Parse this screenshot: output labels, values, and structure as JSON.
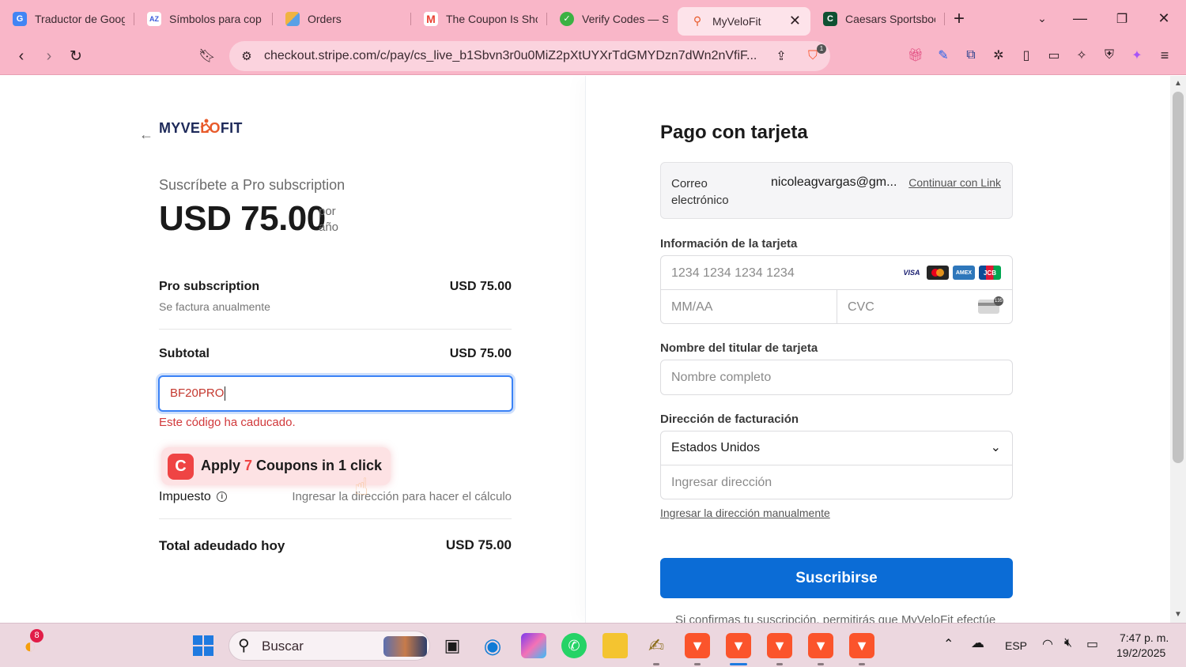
{
  "browser": {
    "tabs": [
      {
        "title": "Traductor de Goog",
        "favicon_color": "#4285f4",
        "favicon_glyph": "G"
      },
      {
        "title": "Símbolos para cop",
        "favicon_color": "#3b5bdb",
        "favicon_glyph": "AZ"
      },
      {
        "title": "Orders",
        "favicon_color": "#e3a13a",
        "favicon_glyph": "▦"
      },
      {
        "title": "The Coupon Is Sho",
        "favicon_color": "#ea4335",
        "favicon_glyph": "M"
      },
      {
        "title": "Verify Codes — Si",
        "favicon_color": "#3bb143",
        "favicon_glyph": "✓"
      },
      {
        "title": "MyVeloFit",
        "favicon_color": "#e85a2a",
        "favicon_glyph": "⚲",
        "active": true
      },
      {
        "title": "Caesars Sportsboo",
        "favicon_color": "#0f5132",
        "favicon_glyph": "C"
      }
    ],
    "url": "checkout.stripe.com/c/pay/cs_live_b1Sbvn3r0u0MiZ2pXtUYXrTdGMYDzn7dWn2nVfiF...",
    "shield_badge": "1"
  },
  "checkout": {
    "logo_part1": "MYVE",
    "logo_part2": "LO",
    "logo_part3": "FIT",
    "subscribe_title": "Suscríbete a Pro subscription",
    "price": "USD 75.00",
    "period_line1": "por",
    "period_line2": "año",
    "item_name": "Pro subscription",
    "item_price": "USD 75.00",
    "item_billing": "Se factura anualmente",
    "subtotal_label": "Subtotal",
    "subtotal_value": "USD 75.00",
    "coupon_value": "BF20PRO",
    "coupon_error": "Este código ha caducado.",
    "tax_label": "Impuesto",
    "tax_hint": "Ingresar la dirección para hacer el cálculo",
    "total_label": "Total adeudado hoy",
    "total_value": "USD 75.00"
  },
  "extension_popup": {
    "prefix": "Apply ",
    "count": "7",
    "suffix": " Coupons in 1 click",
    "badge_glyph": "C"
  },
  "payment": {
    "title": "Pago con tarjeta",
    "email_label": "Correo electrónico",
    "email_value": "nicoleagvargas@gm...",
    "link_button": "Continuar con Link",
    "card_info_label": "Información de la tarjeta",
    "card_number_placeholder": "1234 1234 1234 1234",
    "expiry_placeholder": "MM/AA",
    "cvc_placeholder": "CVC",
    "card_brands": [
      "VISA",
      "MC",
      "AMEX",
      "JCB"
    ],
    "holder_label": "Nombre del titular de tarjeta",
    "holder_placeholder": "Nombre completo",
    "billing_label": "Dirección de facturación",
    "country": "Estados Unidos",
    "address_placeholder": "Ingresar dirección",
    "manual_address_link": "Ingresar la dirección manualmente",
    "submit_label": "Suscribirse",
    "footnote": "Si confirmas tu suscripción, permitirás que MyVeloFit efectúe"
  },
  "taskbar": {
    "notification_count": "8",
    "search_placeholder": "Buscar",
    "language": "ESP",
    "time": "7:47 p. m.",
    "date": "19/2/2025"
  }
}
